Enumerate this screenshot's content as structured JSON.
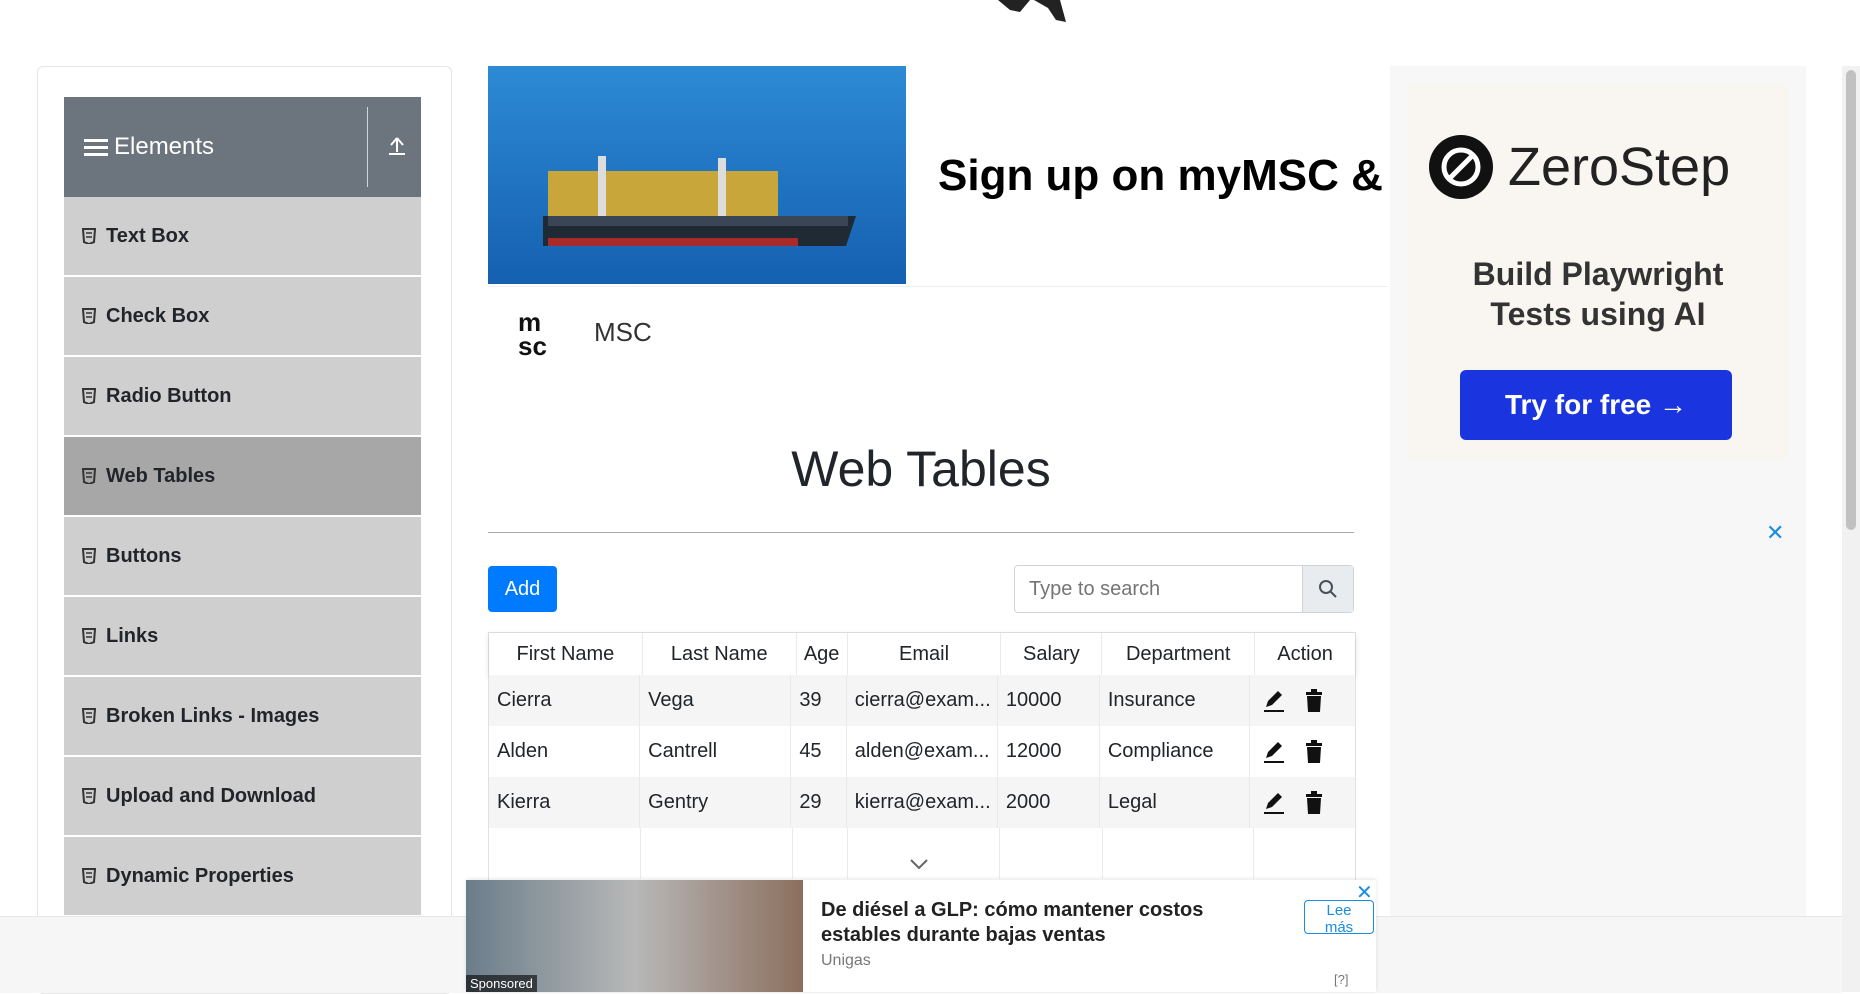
{
  "sidebar": {
    "group_title": "Elements",
    "items": [
      {
        "label": "Text Box"
      },
      {
        "label": "Check Box"
      },
      {
        "label": "Radio Button"
      },
      {
        "label": "Web Tables",
        "active": true
      },
      {
        "label": "Buttons"
      },
      {
        "label": "Links"
      },
      {
        "label": "Broken Links - Images"
      },
      {
        "label": "Upload and Download"
      },
      {
        "label": "Dynamic Properties"
      }
    ]
  },
  "banner": {
    "headline": "Sign up on myMSC & B",
    "brand": "MSC"
  },
  "main": {
    "title": "Web Tables",
    "add_label": "Add",
    "search_placeholder": "Type to search"
  },
  "table": {
    "headers": [
      "First Name",
      "Last Name",
      "Age",
      "Email",
      "Salary",
      "Department",
      "Action"
    ],
    "rows": [
      [
        "Cierra",
        "Vega",
        "39",
        "cierra@exam...",
        "10000",
        "Insurance"
      ],
      [
        "Alden",
        "Cantrell",
        "45",
        "alden@exam...",
        "12000",
        "Compliance"
      ],
      [
        "Kierra",
        "Gentry",
        "29",
        "kierra@exam...",
        "2000",
        "Legal"
      ]
    ]
  },
  "ad_right": {
    "brand": "ZeroStep",
    "tagline_1": "Build Playwright",
    "tagline_2": "Tests using AI",
    "cta": "Try for free →",
    "close": "✕"
  },
  "ad_bottom": {
    "headline": "De diésel a GLP: cómo mantener costos estables durante bajas ventas",
    "brand": "Unigas",
    "sponsored": "Sponsored",
    "cta": "Lee más",
    "close": "✕",
    "choices": "[?]"
  },
  "colors": {
    "primary": "#007bff",
    "sidebar_header": "#6c757d",
    "sidebar_item": "#cfcfcf",
    "sidebar_active": "#a7a7a7",
    "zerostep_button": "#1a35e0"
  }
}
